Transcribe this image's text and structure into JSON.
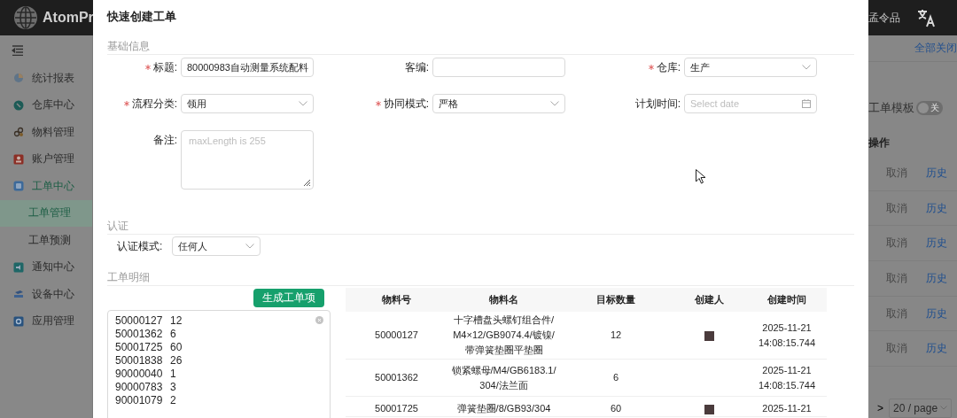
{
  "header": {
    "logo_text": "AtomPr",
    "user": "孟令品"
  },
  "sidebar": {
    "items": [
      {
        "label": "统计报表",
        "expanded": false
      },
      {
        "label": "仓库中心",
        "expanded": false
      },
      {
        "label": "物料管理",
        "expanded": false
      },
      {
        "label": "账户管理",
        "expanded": false
      },
      {
        "label": "工单中心",
        "expanded": true,
        "children": [
          {
            "label": "工单管理",
            "selected": true
          },
          {
            "label": "工单预测",
            "selected": false
          }
        ]
      },
      {
        "label": "通知中心",
        "expanded": false
      },
      {
        "label": "设备中心",
        "expanded": false
      },
      {
        "label": "应用管理",
        "expanded": false
      }
    ]
  },
  "right_panel": {
    "close_all": "全部关闭",
    "template_toggle": {
      "label": "工单模板",
      "on": false,
      "text": "关"
    },
    "actions_header": "操作",
    "rows": [
      {
        "cancel": "取消",
        "disabled": true,
        "history": "历史"
      },
      {
        "cancel": "取消",
        "disabled": true,
        "history": "历史"
      },
      {
        "cancel": "取消",
        "disabled": true,
        "history": "历史"
      },
      {
        "cancel": "取消",
        "disabled": true,
        "history": "历史"
      },
      {
        "cancel": "取消",
        "disabled": true,
        "history": "历史"
      },
      {
        "cancel": "取消",
        "disabled": true,
        "history": "历史"
      }
    ],
    "pagination": {
      "next": ">",
      "page_size": "20 / page"
    }
  },
  "modal": {
    "title": "快速创建工单",
    "basic": {
      "title": "基础信息",
      "fields": [
        {
          "label": "标题:",
          "required": true,
          "kind": "input",
          "value": "80000983自动测量系统配料"
        },
        {
          "label": "客编:",
          "required": false,
          "kind": "input"
        },
        {
          "label": "仓库:",
          "required": true,
          "kind": "select",
          "value": "生产"
        },
        {
          "label": "流程分类:",
          "required": true,
          "kind": "select",
          "value": "领用"
        },
        {
          "label": "协同模式:",
          "required": true,
          "kind": "select",
          "value": "严格"
        },
        {
          "label": "计划时间:",
          "required": false,
          "kind": "date",
          "placeholder": "Select date"
        },
        {
          "label": "备注:",
          "required": false,
          "kind": "textarea",
          "placeholder": "maxLength is 255"
        }
      ]
    },
    "auth": {
      "title": "认证",
      "label": "认证模式:",
      "value": "任何人"
    },
    "detail": {
      "title": "工单明细",
      "generate_button": "生成工单项",
      "lines": [
        {
          "code": "50000127",
          "qty": "12"
        },
        {
          "code": "50001362",
          "qty": "6"
        },
        {
          "code": "50001725",
          "qty": "60"
        },
        {
          "code": "50001838",
          "qty": "26"
        },
        {
          "code": "90000040",
          "qty": "1"
        },
        {
          "code": "90000783",
          "qty": "3"
        },
        {
          "code": "90001079",
          "qty": "2"
        }
      ],
      "table": {
        "columns": [
          "物料号",
          "物料名",
          "目标数量",
          "创建人",
          "创建时间"
        ],
        "rows": [
          {
            "material_no": "50000127",
            "name": "十字槽盘头螺钉组合件/M4×12/GB9074.4/镀镍/带弹簧垫圈平垫圈",
            "quantity": "12",
            "avatar": true,
            "created": "2025-11-21 14:08:15.744"
          },
          {
            "material_no": "50001362",
            "name": "锁紧螺母/M4/GB6183.1/304/法兰面",
            "quantity": "6",
            "avatar": false,
            "created": "2025-11-21 14:08:15.744"
          },
          {
            "material_no": "50001725",
            "name": "弹簧垫圈/8/GB93/304",
            "quantity": "60",
            "avatar": true,
            "created": "2025-11-21"
          }
        ]
      }
    }
  }
}
